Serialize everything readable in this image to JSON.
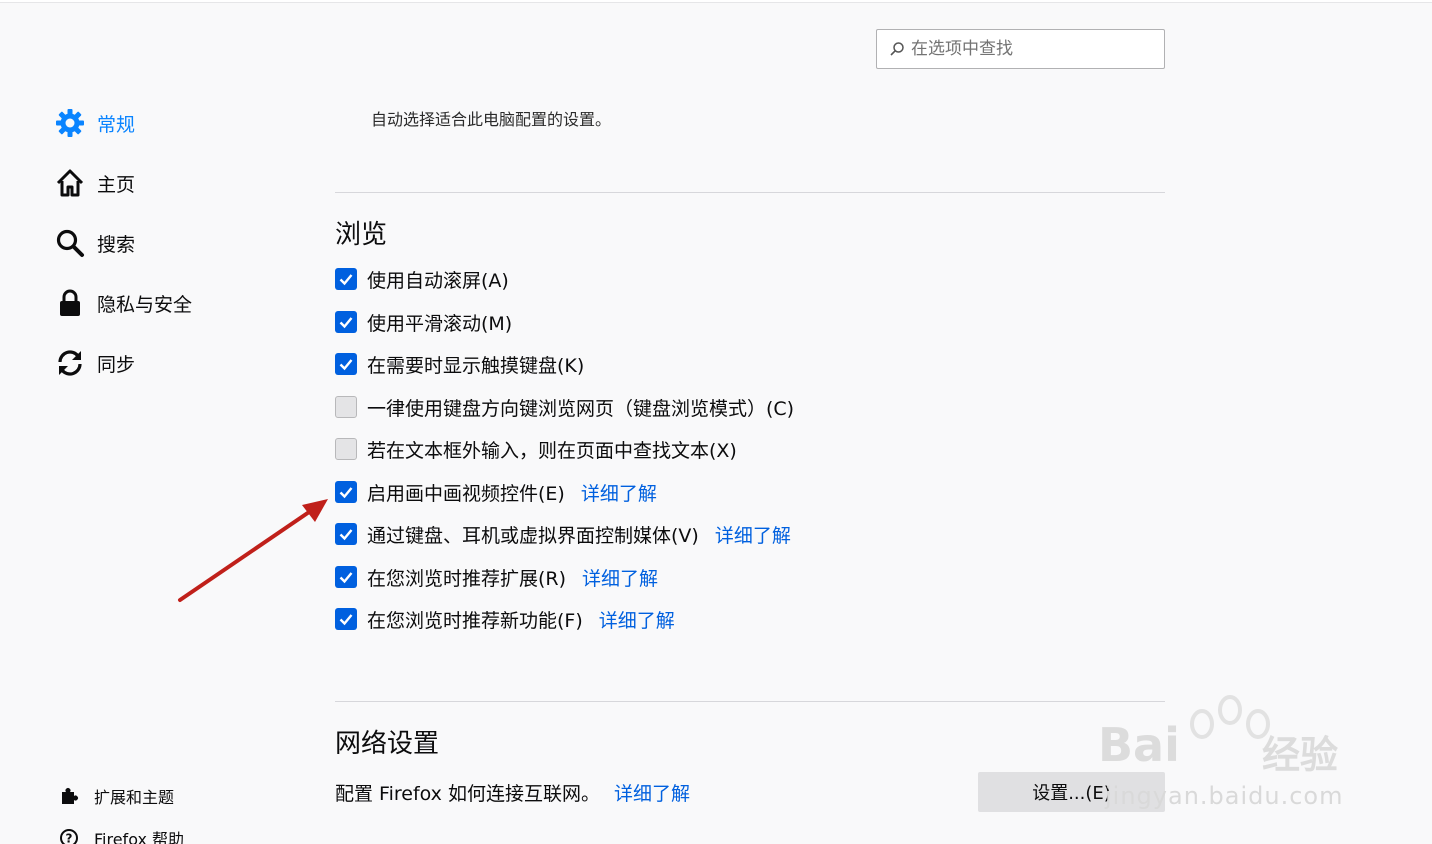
{
  "search": {
    "placeholder": "在选项中查找",
    "icon": "search-icon"
  },
  "sidebar": {
    "items": [
      {
        "label": "常规",
        "icon": "gear-icon",
        "selected": true
      },
      {
        "label": "主页",
        "icon": "home-icon",
        "selected": false
      },
      {
        "label": "搜索",
        "icon": "search-icon",
        "selected": false
      },
      {
        "label": "隐私与安全",
        "icon": "lock-icon",
        "selected": false
      },
      {
        "label": "同步",
        "icon": "sync-icon",
        "selected": false
      }
    ],
    "footer": [
      {
        "label": "扩展和主题",
        "icon": "puzzle-icon"
      },
      {
        "label": "Firefox 帮助",
        "icon": "help-icon"
      }
    ]
  },
  "main": {
    "performance_description": "自动选择适合此电脑配置的设置。",
    "browsing": {
      "title": "浏览",
      "options": [
        {
          "label": "使用自动滚屏(A)",
          "checked": true,
          "link": ""
        },
        {
          "label": "使用平滑滚动(M)",
          "checked": true,
          "link": ""
        },
        {
          "label": "在需要时显示触摸键盘(K)",
          "checked": true,
          "link": ""
        },
        {
          "label": "一律使用键盘方向键浏览网页（键盘浏览模式）(C)",
          "checked": false,
          "link": ""
        },
        {
          "label": "若在文本框外输入，则在页面中查找文本(X)",
          "checked": false,
          "link": ""
        },
        {
          "label": "启用画中画视频控件(E)",
          "checked": true,
          "link": "详细了解"
        },
        {
          "label": "通过键盘、耳机或虚拟界面控制媒体(V)",
          "checked": true,
          "link": "详细了解"
        },
        {
          "label": "在您浏览时推荐扩展(R)",
          "checked": true,
          "link": "详细了解"
        },
        {
          "label": "在您浏览时推荐新功能(F)",
          "checked": true,
          "link": "详细了解"
        }
      ]
    },
    "network": {
      "title": "网络设置",
      "description": "配置 Firefox 如何连接互联网。",
      "link": "详细了解",
      "button_label": "设置...(E)"
    }
  },
  "watermark": {
    "brand": "Bai",
    "brand_cn": "经验",
    "url": "jingyan.baidu.com"
  },
  "colors": {
    "accent": "#0060df",
    "selected_nav": "#0a84ff",
    "arrow": "#c0201a"
  }
}
